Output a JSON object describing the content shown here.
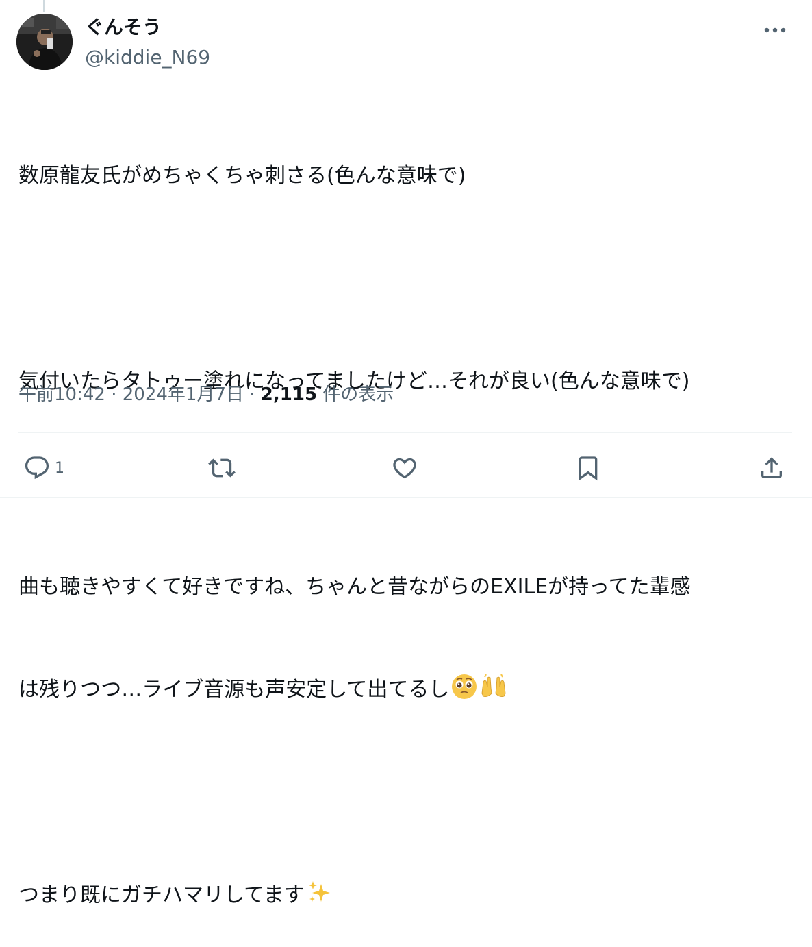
{
  "author": {
    "display_name": "ぐんそう",
    "handle": "@kiddie_N69"
  },
  "tweet": {
    "lines": [
      "数原龍友氏がめちゃくちゃ刺さる(色んな意味で)",
      "",
      "気付いたらタトゥー塗れになってましたけど…それが良い(色んな意味で)",
      "",
      "曲も聴きやすくて好きですね、ちゃんと昔ながらのEXILEが持ってた輩感",
      "は残りつつ…ライブ音源も声安定して出てるし",
      "",
      "つまり既にガチハマリしてます"
    ],
    "emojis": {
      "line6": [
        "pleading-face-emoji",
        "raising-hands-emoji"
      ],
      "line8": [
        "sparkles-emoji"
      ]
    }
  },
  "meta": {
    "time": "午前10:42",
    "separator": " · ",
    "date": "2024年1月7日",
    "views_count": "2,115",
    "views_label": " 件の表示"
  },
  "actions": {
    "reply_count": "1",
    "reply_icon": "reply-icon",
    "retweet_icon": "retweet-icon",
    "like_icon": "heart-icon",
    "bookmark_icon": "bookmark-icon",
    "share_icon": "share-icon"
  },
  "colors": {
    "text_primary": "#0f1419",
    "text_secondary": "#536471",
    "divider": "#eff3f4"
  }
}
